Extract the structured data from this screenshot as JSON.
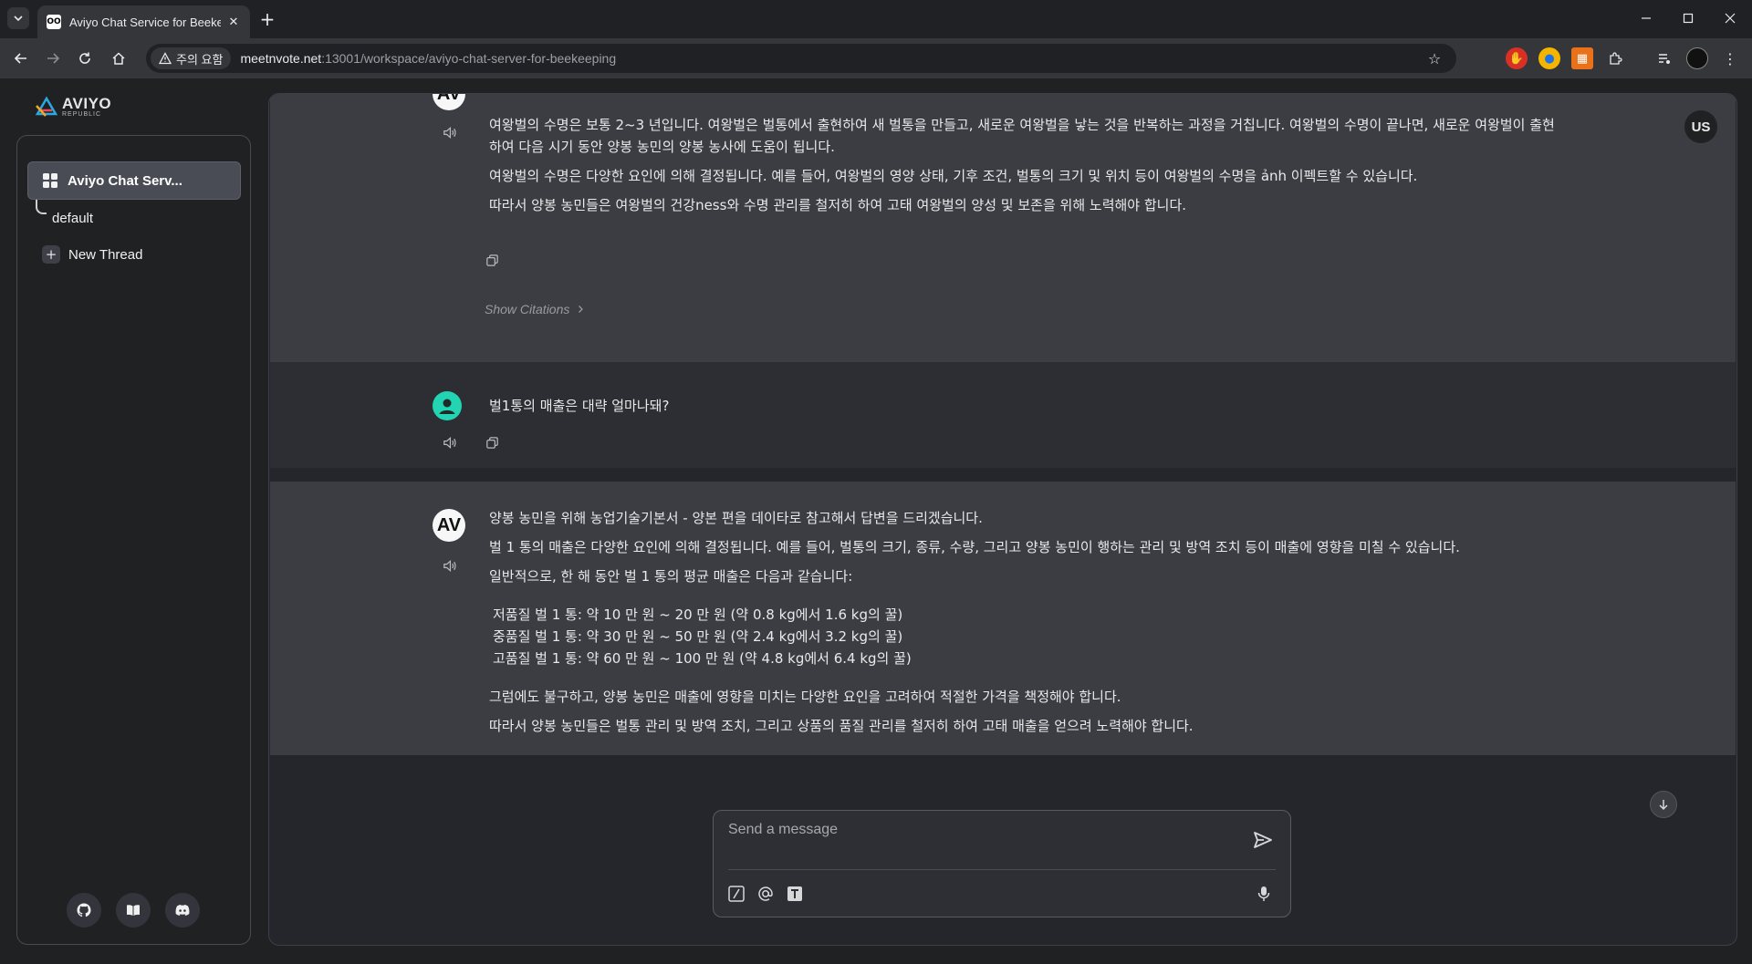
{
  "browser": {
    "tab_title": "Aviyo Chat Service for Beekeeping",
    "favicon_text": "OO",
    "security_label": "주의 요함",
    "url_host": "meetnvote.net",
    "url_rest": ":13001/workspace/aviyo-chat-server-for-beekeeping"
  },
  "app": {
    "logo_name": "AVIYO",
    "logo_sub": "REPUBLIC"
  },
  "sidebar": {
    "workspace_label": "Aviyo Chat Serv...",
    "thread_label": "default",
    "new_thread_label": "New Thread"
  },
  "chat": {
    "user_badge": "US",
    "avatar_text": "AV",
    "message1": {
      "paragraphs": [
        "여왕벌의 수명은 보통 2~3 년입니다. 여왕벌은 벌통에서 출현하여 새 벌통을 만들고, 새로운 여왕벌을 낳는 것을 반복하는 과정을 거칩니다. 여왕벌의 수명이 끝나면, 새로운 여왕벌이 출현하여 다음 시기 동안 양봉 농민의 양봉 농사에 도움이 됩니다.",
        "여왕벌의 수명은 다양한 요인에 의해 결정됩니다. 예를 들어, 여왕벌의 영양 상태, 기후 조건, 벌통의 크기 및 위치 등이 여왕벌의 수명을 ảnh 이펙트할 수 있습니다.",
        "따라서 양봉 농민들은 여왕벌의 건강ness와 수명 관리를 철저히 하여 고태 여왕벌의 양성 및 보존을 위해 노력해야 합니다."
      ],
      "show_citations": "Show Citations"
    },
    "message2": {
      "text": "벌1통의 매출은 대략 얼마나돼?"
    },
    "message3": {
      "intro": "양봉 농민을 위해 농업기술기본서 - 양본 편을 데이타로 참고해서 답변을 드리겠습니다.",
      "p1": "벌 1 통의 매출은 다양한 요인에 의해 결정됩니다. 예를 들어, 벌통의 크기, 종류, 수량, 그리고 양봉 농민이 행하는 관리 및 방역 조치 등이 매출에 영향을 미칠 수 있습니다.",
      "p2": "일반적으로, 한 해 동안 벌 1 통의 평균 매출은 다음과 같습니다:",
      "list": [
        "저품질 벌 1 통: 약 10 만 원 ~ 20 만 원 (약 0.8 kg에서 1.6 kg의 꿀)",
        "중품질 벌 1 통: 약 30 만 원 ~ 50 만 원 (약 2.4 kg에서 3.2 kg의 꿀)",
        "고품질 벌 1 통: 약 60 만 원 ~ 100 만 원 (약 4.8 kg에서 6.4 kg의 꿀)"
      ],
      "p3": "그럼에도 불구하고, 양봉 농민은 매출에 영향을 미치는 다양한 요인을 고려하여 적절한 가격을 책정해야 합니다.",
      "p4": "따라서 양봉 농민들은 벌통 관리 및 방역 조치, 그리고 상품의 품질 관리를 철저히 하여 고태 매출을 얻으려 노력해야 합니다."
    }
  },
  "composer": {
    "placeholder": "Send a message"
  }
}
